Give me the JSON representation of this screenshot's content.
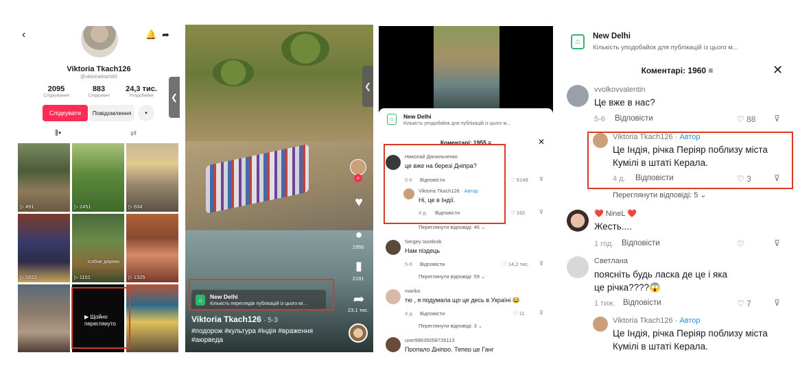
{
  "profile": {
    "name": "Viktoria Tkach126",
    "handle": "@viktoriatkach83",
    "back_icon": "‹",
    "bell_icon": "🔔",
    "share_icon": "➦",
    "stats": [
      {
        "value": "2095",
        "label": "Слідкування"
      },
      {
        "value": "883",
        "label": "Слідкувачі"
      },
      {
        "value": "24,3 тис.",
        "label": "Уподобайки"
      }
    ],
    "follow_label": "Слідкувати",
    "message_label": "Повідомлення",
    "more_label": "▾",
    "tab_grid": "⫼▾",
    "tab_repost": "⇄",
    "grid": [
      {
        "count": "▷ 491",
        "caption": ""
      },
      {
        "count": "▷ 2451",
        "caption": ""
      },
      {
        "count": "▷ 634",
        "caption": ""
      },
      {
        "count": "▷ 1823",
        "caption": ""
      },
      {
        "count": "▷ 1151",
        "caption": "Хлібне дерево"
      },
      {
        "count": "▷ 1325",
        "caption": ""
      },
      {
        "count": "",
        "caption": ""
      },
      {
        "count": "",
        "caption": ""
      },
      {
        "count": "",
        "caption": ""
      }
    ],
    "seen_label_1": "▶ Щойно",
    "seen_label_2": "переглянуто"
  },
  "video": {
    "location_title": "New Delhi",
    "location_sub": "Кількість переглядів публікацій із цього мі...",
    "author": "Viktoria Tkach126",
    "date": "· 5-3",
    "tags": "#подорож #культура #індія #враження #аюрведа",
    "comments_count": "1955",
    "bookmarks_count": "2191",
    "shares_count": "23,1 тис.",
    "side_tab_icon": "❮"
  },
  "comments_small": {
    "location_title": "New Delhi",
    "location_sub": "Кількість уподобайок для публікацій із цього м...",
    "header": "Коментарі: 1955 ≡",
    "close": "✕",
    "side_tab_icon": "❮",
    "items": [
      {
        "name": "Николай Данильченко",
        "text": "це вже на березі Дніпра?",
        "date": "5-6",
        "reply": "Відповісти",
        "likes": "♡ 5148",
        "dislike": "⊽"
      },
      {
        "name": "Viktoria Tkach126",
        "author_tag": "· Автор",
        "text": "Ні, це в Індії.",
        "date": "4 д.",
        "reply": "Відповісти",
        "likes": "♡ 162",
        "dislike": "⊽"
      },
      {
        "more": "Переглянути відповіді: 46 ⌄"
      },
      {
        "name": "Sergey Iazebnik",
        "text": "Нам піздець",
        "date": "5-6",
        "reply": "Відповісти",
        "likes": "♡ 14,2 тис.",
        "dislike": "⊽"
      },
      {
        "more": "Переглянути відповіді: 59 ⌄"
      },
      {
        "name": "mariko",
        "text": "тю , я подумала що це десь в Україні 😂",
        "date": "4 д.",
        "reply": "Відповісти",
        "likes": "♡ 11",
        "dislike": "⊽"
      },
      {
        "more": "Переглянути відповіді: 3 ⌄"
      },
      {
        "name": "user99635058726113",
        "text": "Пропало Дніпро. Тепер це Ганг"
      }
    ]
  },
  "comments_large": {
    "location_title": "New Delhi",
    "location_sub": "Кількість уподобайок для публікацій із цього м...",
    "header": "Коментарі: 1960 ≡",
    "close": "✕",
    "items": [
      {
        "name": "vvolkovvalentin",
        "text": "Це вже в нас?",
        "date": "5-6",
        "reply": "Відповісти",
        "likes": "♡ 88",
        "dislike": "⊽"
      },
      {
        "name": "Viktoria Tkach126",
        "author_tag": "· Автор",
        "text": "Це Індія, річка Періяр поблизу міста Кумілі в штаті Керала.",
        "date": "4 д.",
        "reply": "Відповісти",
        "likes": "♡ 3",
        "dislike": "⊽"
      },
      {
        "more": "Переглянути відповіді: 5 ⌄"
      },
      {
        "name": "❤️ NineL ❤️",
        "text": "Жесть....",
        "date": "1 год.",
        "reply": "Відповісти",
        "likes": "♡",
        "dislike": "⊽"
      },
      {
        "name": "Светлана",
        "text": "поясніть будь ласка де це і яка це річка????😱",
        "date": "1 тиж.",
        "reply": "Відповісти",
        "likes": "♡ 7",
        "dislike": "⊽"
      },
      {
        "name": "Viktoria Tkach126",
        "author_tag": "· Автор",
        "text": "Це Індія, річка Періяр поблизу міста Кумілі в штаті Керала."
      }
    ]
  },
  "colors": {
    "accent": "#fe2c55",
    "highlight_box": "#d93a26",
    "location_green": "#2fb56a",
    "author_blue": "#2b8fd6"
  }
}
